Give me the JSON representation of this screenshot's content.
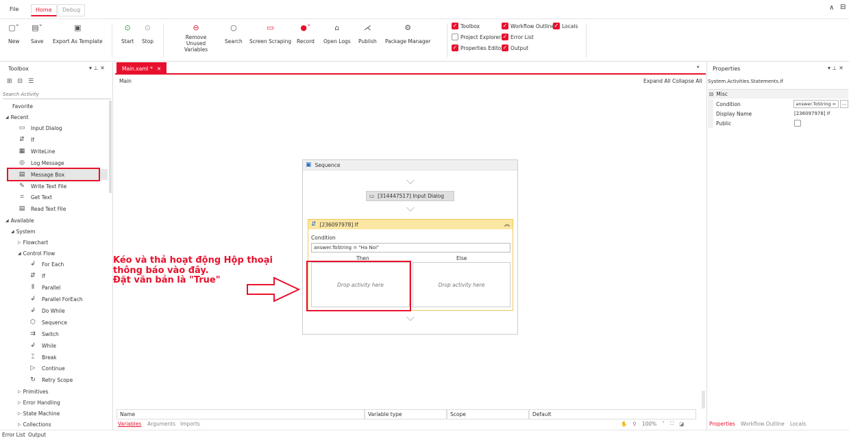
{
  "menu": {
    "file": "File",
    "home": "Home",
    "debug": "Debug"
  },
  "ribbon": {
    "buttons": [
      {
        "label": "New",
        "icon": "new-icon"
      },
      {
        "label": "Save",
        "icon": "save-icon"
      },
      {
        "label": "Export As Template",
        "icon": "export-template-icon"
      },
      {
        "label": "Start",
        "icon": "start-icon"
      },
      {
        "label": "Stop",
        "icon": "stop-icon"
      },
      {
        "label": "Remove Unused Variables",
        "icon": "remove-variables-icon"
      },
      {
        "label": "Search",
        "icon": "search-icon"
      },
      {
        "label": "Screen Scraping",
        "icon": "screen-scraping-icon"
      },
      {
        "label": "Record",
        "icon": "record-icon"
      },
      {
        "label": "Open Logs",
        "icon": "open-logs-icon"
      },
      {
        "label": "Publish",
        "icon": "publish-icon"
      },
      {
        "label": "Package Manager",
        "icon": "package-manager-icon"
      }
    ],
    "checks": [
      {
        "label": "Toolbox",
        "checked": true
      },
      {
        "label": "Project Explorer",
        "checked": false
      },
      {
        "label": "Properties Editor",
        "checked": true
      },
      {
        "label": "Workflow Outline",
        "checked": true
      },
      {
        "label": "Error List",
        "checked": true
      },
      {
        "label": "Output",
        "checked": true
      },
      {
        "label": "Locals",
        "checked": true
      }
    ]
  },
  "toolbox": {
    "title": "Toolbox",
    "search_placeholder": "Search Activity",
    "favorite": "Favorite",
    "recent": "Recent",
    "recent_items": [
      "Input Dialog",
      "If",
      "WriteLine",
      "Log Message",
      "Message Box",
      "Write Text File",
      "Get Text",
      "Read Text File"
    ],
    "available": "Available",
    "system": "System",
    "flowchart": "Flowchart",
    "control_flow": "Control Flow",
    "control_items": [
      "For Each",
      "If",
      "Parallel",
      "Parallel ForEach",
      "Do While",
      "Sequence",
      "Switch",
      "While",
      "Break",
      "Continue",
      "Retry Scope"
    ],
    "primitives": "Primitives",
    "error_handling": "Error Handling",
    "state_machine": "State Machine",
    "collections": "Collections"
  },
  "designer": {
    "tab": "Main.xaml *",
    "breadcrumb": "Main",
    "expand_all": "Expand All",
    "collapse_all": "Collapse All",
    "sequence_title": "Sequence",
    "input_dialog": "[314447517] Input Dialog",
    "if_title": "[236097978] If",
    "condition_label": "Condition",
    "condition_value": "answer.ToString = \"Ha Noi\"",
    "then": "Then",
    "else": "Else",
    "drop_then": "Drop activity here",
    "drop_else": "Drop activity here"
  },
  "annotation": {
    "line1": "Kéo và thả hoạt động Hộp thoại",
    "line2": "thông báo vào đây.",
    "line3": "Đặt văn bản là \"True\""
  },
  "variables": {
    "cols": [
      "Name",
      "Variable type",
      "Scope",
      "Default"
    ],
    "tabs": [
      "Variables",
      "Arguments",
      "Imports"
    ],
    "zoom": "100%"
  },
  "properties": {
    "title": "Properties",
    "type": "System.Activities.Statements.If",
    "category": "Misc",
    "rows": [
      {
        "name": "Condition",
        "value": "answer.ToString ="
      },
      {
        "name": "Display Name",
        "value": "[236097978] If"
      },
      {
        "name": "Public",
        "value": ""
      }
    ],
    "bottom_tabs": [
      "Properties",
      "Workflow Outline",
      "Locals"
    ]
  },
  "status": {
    "error_list": "Error List",
    "output": "Output"
  },
  "colors": {
    "accent": "#e8112d"
  }
}
